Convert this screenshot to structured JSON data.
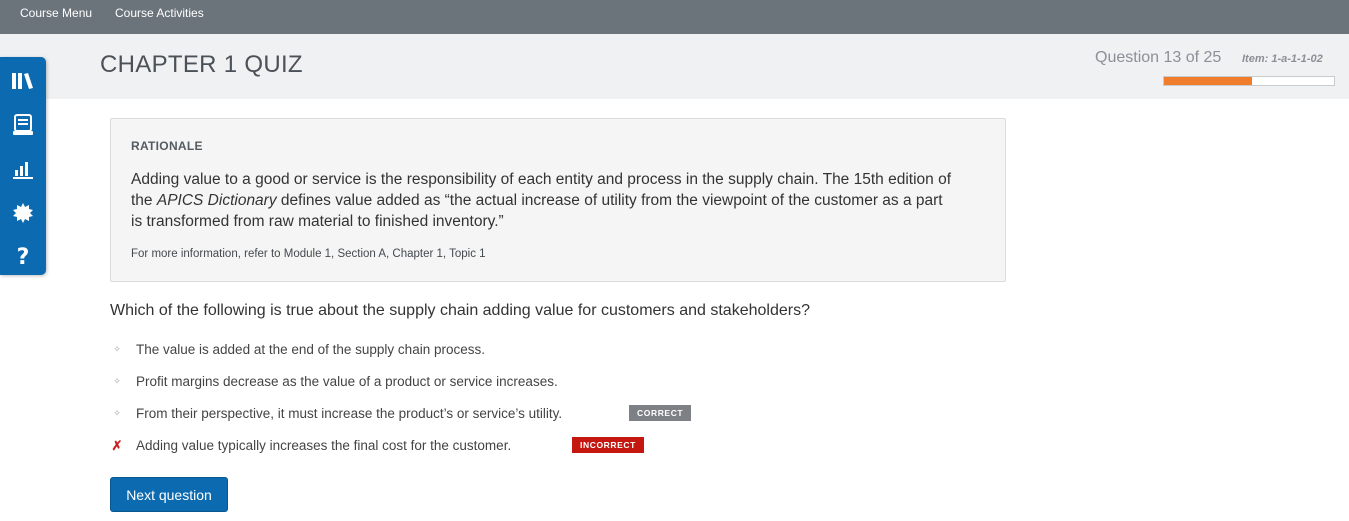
{
  "nav": {
    "course_menu": "Course Menu",
    "course_activities": "Course Activities"
  },
  "header": {
    "title": "CHAPTER 1 QUIZ",
    "progress_text": "Question 13 of 25",
    "item_id": "Item: 1-a-1-1-02",
    "progress_fraction": 0.52,
    "progress_color": "#ef7d2b"
  },
  "sidebar": {
    "items": [
      {
        "icon": "library-icon"
      },
      {
        "icon": "notebook-icon"
      },
      {
        "icon": "bar-chart-icon"
      },
      {
        "icon": "gear-icon"
      },
      {
        "icon": "help-icon",
        "glyph": "?"
      }
    ]
  },
  "rationale": {
    "heading": "RATIONALE",
    "body_before": "Adding value to a good or service is the responsibility of each entity and process in the supply chain. The 15th edition of the ",
    "body_italic": "APICS Dictionary",
    "body_after": " defines value added as “the actual increase of utility from the viewpoint of the customer as a part is transformed from raw material to finished inventory.”",
    "reference": "For more information, refer to Module 1, Section A, Chapter 1, Topic 1"
  },
  "question": {
    "text": "Which of the following is true about the supply chain adding value for customers and stakeholders?",
    "answers": [
      {
        "marker": "✧",
        "text": "The value is added at the end of the supply chain process."
      },
      {
        "marker": "✧",
        "text": "Profit margins decrease as the value of a product or service increases."
      },
      {
        "marker": "✧",
        "text": "From their perspective, it must increase the product’s or service’s utility.",
        "badge": "CORRECT"
      },
      {
        "marker": "✗",
        "text": "Adding value typically increases the final cost for the customer.",
        "badge": "INCORRECT"
      }
    ]
  },
  "next_button": "Next question",
  "colors": {
    "topbar": "#6b737b",
    "accent_blue": "#0b6ab0",
    "correct_badge": "#7d8186",
    "incorrect_badge": "#c4170f"
  }
}
